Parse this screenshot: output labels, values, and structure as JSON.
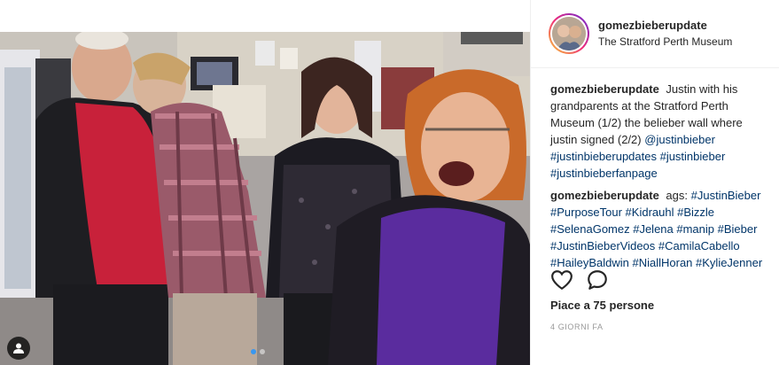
{
  "post": {
    "username": "gomezbieberupdate",
    "location": "The Stratford Perth Museum",
    "caption_author": "gomezbieberupdate",
    "caption_text": "Justin with his grandparents at the Stratford Perth Museum (1/2) the belieber wall where justin signed (2/2)",
    "caption_tags": "@justinbieber #justinbieberupdates #justinbieber #justinbieberfanpage",
    "comment_author": "gomezbieberupdate",
    "comment_prefix": "ags:",
    "comment_tags": "#JustinBieber #PurposeTour #Kidrauhl #Bizzle #SelenaGomez #Jelena #manip #Bieber #JustinBieberVideos #CamilaCabello #HaileyBaldwin #NiallHoran #KylieJenner",
    "likes": "Piace a 75 persone",
    "timestamp": "4 GIORNI FA"
  },
  "icons": {
    "like": "heart-icon",
    "comment": "comment-bubble-icon",
    "tag": "user-tag-icon"
  },
  "colors": {
    "tag_link": "#003569",
    "active_dot": "#3897f0",
    "muted_text": "#999999"
  }
}
